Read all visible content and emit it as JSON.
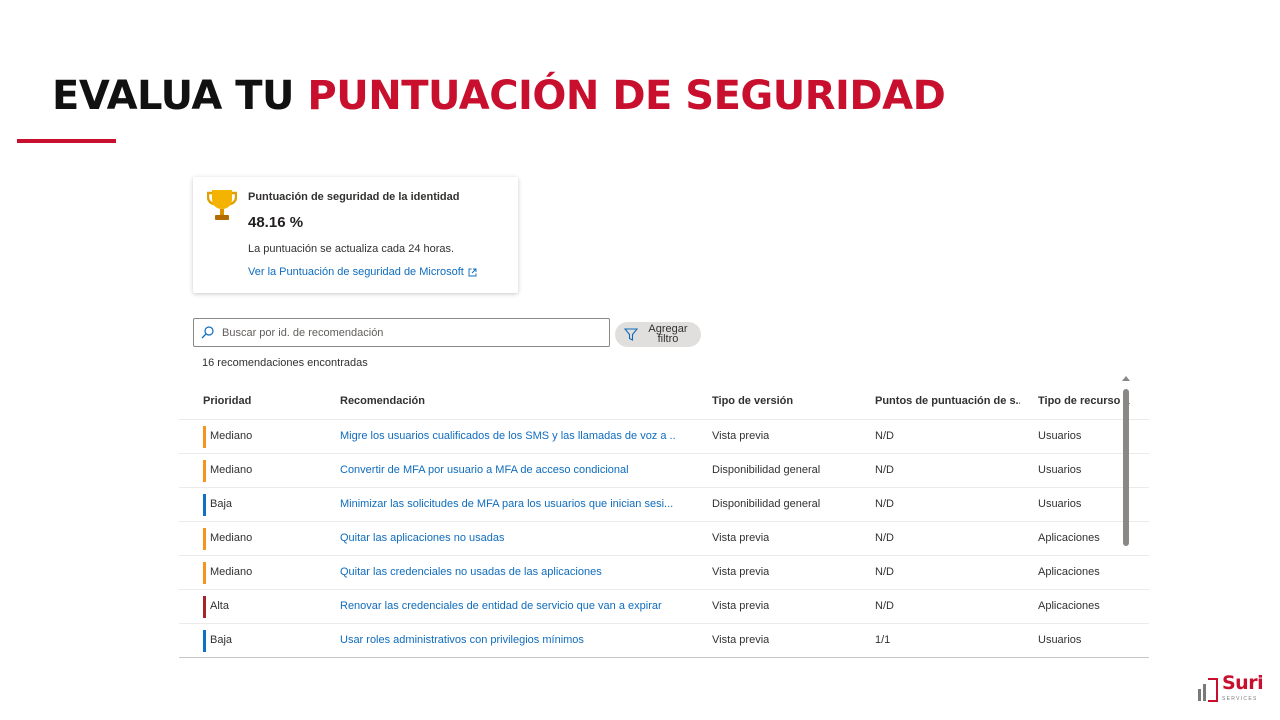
{
  "slide": {
    "title_part1": "EVALUA TU",
    "title_part2": "PUNTUACIÓN DE SEGURIDAD"
  },
  "score_card": {
    "icon": "trophy-icon",
    "title": "Puntuación de seguridad de la identidad",
    "value": "48.16 %",
    "note": "La puntuación se actualiza cada 24 horas.",
    "link": "Ver la Puntuación de seguridad de Microsoft",
    "link_icon": "external-link-icon"
  },
  "search": {
    "placeholder": "Buscar por id. de recomendación",
    "value": ""
  },
  "filter_button": {
    "label": "Agregar filtro"
  },
  "results_count": "16 recomendaciones encontradas",
  "table": {
    "columns": [
      "Prioridad",
      "Recomendación",
      "Tipo de versión",
      "Puntos de puntuación de s...",
      "Tipo de recurso a"
    ],
    "rows": [
      {
        "priority": "Mediano",
        "recommendation": "Migre los usuarios cualificados de los SMS y las llamadas de voz a ...",
        "version": "Vista previa",
        "points": "N/D",
        "resource": "Usuarios"
      },
      {
        "priority": "Mediano",
        "recommendation": "Convertir de MFA por usuario a MFA de acceso condicional",
        "version": "Disponibilidad general",
        "points": "N/D",
        "resource": "Usuarios"
      },
      {
        "priority": "Baja",
        "recommendation": "Minimizar las solicitudes de MFA para los usuarios que inician sesi...",
        "version": "Disponibilidad general",
        "points": "N/D",
        "resource": "Usuarios"
      },
      {
        "priority": "Mediano",
        "recommendation": "Quitar las aplicaciones no usadas",
        "version": "Vista previa",
        "points": "N/D",
        "resource": "Aplicaciones"
      },
      {
        "priority": "Mediano",
        "recommendation": "Quitar las credenciales no usadas de las aplicaciones",
        "version": "Vista previa",
        "points": "N/D",
        "resource": "Aplicaciones"
      },
      {
        "priority": "Alta",
        "recommendation": "Renovar las credenciales de entidad de servicio que van a expirar",
        "version": "Vista previa",
        "points": "N/D",
        "resource": "Aplicaciones"
      },
      {
        "priority": "Baja",
        "recommendation": "Usar roles administrativos con privilegios mínimos",
        "version": "Vista previa",
        "points": "1/1",
        "resource": "Usuarios"
      }
    ]
  },
  "priority_colors": {
    "Alta": "#a4262c",
    "Mediano": "#f7941d",
    "Baja": "#1170c3"
  },
  "colors": {
    "accent": "#c8102e",
    "link": "#0f6cbd"
  },
  "logo": {
    "name": "Suri",
    "sub": "SERVICES"
  }
}
